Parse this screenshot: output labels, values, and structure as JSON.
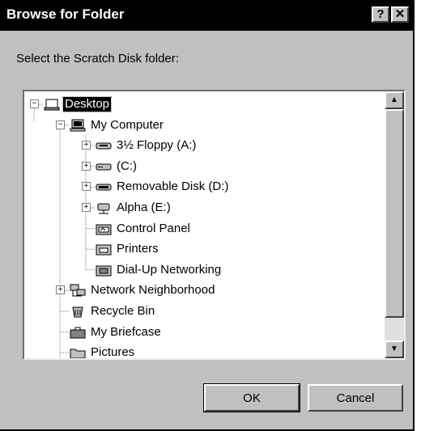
{
  "window": {
    "title": "Browse for Folder",
    "help_glyph": "?",
    "close_glyph": "✕"
  },
  "prompt": "Select the Scratch Disk folder:",
  "tree": {
    "items": [
      {
        "label": "Desktop",
        "icon": "desktop-icon",
        "expander": "−",
        "selected": true
      },
      {
        "label": "My Computer",
        "icon": "computer-icon",
        "expander": "−"
      },
      {
        "label": "3½ Floppy (A:)",
        "icon": "floppy-drive-icon",
        "expander": "+"
      },
      {
        "label": "(C:)",
        "icon": "hard-drive-icon",
        "expander": "+"
      },
      {
        "label": "Removable Disk (D:)",
        "icon": "removable-drive-icon",
        "expander": "+"
      },
      {
        "label": "Alpha (E:)",
        "icon": "network-drive-icon",
        "expander": "+"
      },
      {
        "label": "Control Panel",
        "icon": "control-panel-icon",
        "expander": ""
      },
      {
        "label": "Printers",
        "icon": "printers-icon",
        "expander": ""
      },
      {
        "label": "Dial-Up Networking",
        "icon": "dialup-icon",
        "expander": ""
      },
      {
        "label": "Network Neighborhood",
        "icon": "network-icon",
        "expander": "+"
      },
      {
        "label": "Recycle Bin",
        "icon": "recycle-bin-icon",
        "expander": ""
      },
      {
        "label": "My Briefcase",
        "icon": "briefcase-icon",
        "expander": ""
      },
      {
        "label": "Pictures",
        "icon": "folder-icon",
        "expander": ""
      }
    ]
  },
  "scrollbar": {
    "up_glyph": "▲",
    "down_glyph": "▼"
  },
  "buttons": {
    "ok": "OK",
    "cancel": "Cancel"
  }
}
